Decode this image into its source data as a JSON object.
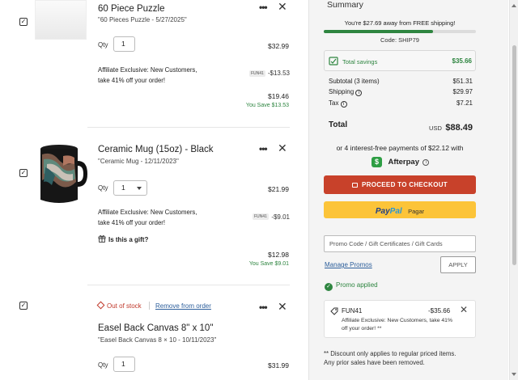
{
  "colors": {
    "accent_green": "#2e8540",
    "checkout_red": "#c8412a",
    "paypal_yellow": "#fcc439",
    "link_blue": "#2c5e9b"
  },
  "items": [
    {
      "title": "60 Piece Puzzle",
      "subtitle": "\"60 Pieces Puzzle - 5/27/2025\"",
      "qty_label": "Qty",
      "qty": "1",
      "price": "$32.99",
      "promo_line1": "Affiliate Exclusive: New Customers,",
      "promo_line2": "take 41% off your order!",
      "code": "FUN41",
      "discount": "-$13.53",
      "final_price": "$19.46",
      "you_save": "You Save $13.53"
    },
    {
      "title": "Ceramic Mug (15oz) - Black",
      "subtitle": "\"Ceramic Mug - 12/11/2023\"",
      "qty_label": "Qty",
      "qty": "1",
      "price": "$21.99",
      "promo_line1": "Affiliate Exclusive: New Customers,",
      "promo_line2": "take 41% off your order!",
      "code": "FUN41",
      "discount": "-$9.01",
      "gift_label": "Is this a gift?",
      "final_price": "$12.98",
      "you_save": "You Save $9.01"
    },
    {
      "out_of_stock": "Out of stock",
      "remove_link": "Remove from order",
      "title": "Easel Back Canvas 8\" x 10\"",
      "subtitle": "\"Easel Back Canvas 8 × 10 - 10/11/2023\"",
      "qty_label": "Qty",
      "qty": "1",
      "price": "$31.99"
    }
  ],
  "summary": {
    "heading": "Summary",
    "shipping_msg": "You're $27.69 away from FREE shipping!",
    "shipping_progress": 0.72,
    "code_line": "Code: SHIP79",
    "total_savings_label": "Total savings",
    "total_savings_value": "$35.66",
    "subtotal_label": "Subtotal (3 items)",
    "subtotal_value": "$51.31",
    "shipping_label": "Shipping",
    "shipping_value": "$29.97",
    "tax_label": "Tax",
    "tax_value": "$7.21",
    "total_label": "Total",
    "total_currency": "USD",
    "total_value": "$88.49",
    "afterpay_line": "or 4 interest-free payments of $22.12 with",
    "afterpay_brand": "Afterpay",
    "checkout_label": "PROCEED TO CHECKOUT",
    "paypal_pay": "Pay",
    "paypal_pal": "Pal",
    "paypal_pagar": "Pagar",
    "promo_placeholder": "Promo Code / Gift Certificates / Gift Cards",
    "manage_promos": "Manage Promos",
    "apply_label": "APPLY",
    "promo_applied": "Promo applied",
    "promo_code": "FUN41",
    "promo_discount": "-$35.66",
    "promo_desc_line1": "Affiliate Exclusive: New Customers, take 41%",
    "promo_desc_line2": "off your order! **",
    "footnote_line1": "** Discount only applies to regular priced items.",
    "footnote_line2": "Any prior sales have been removed."
  }
}
